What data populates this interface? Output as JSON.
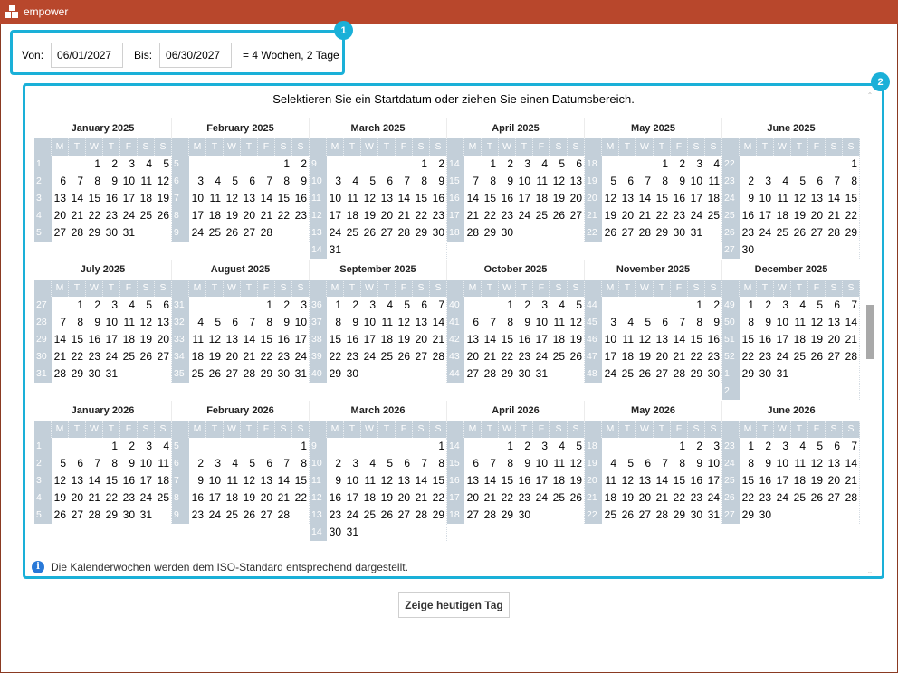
{
  "app": {
    "title": "empower"
  },
  "range": {
    "from_label": "Von:",
    "from_value": "06/01/2027",
    "to_label": "Bis:",
    "to_value": "06/30/2027",
    "result": "= 4 Wochen, 2 Tage",
    "badge": "1"
  },
  "calendar": {
    "badge": "2",
    "heading": "Selektieren Sie ein Startdatum oder ziehen Sie einen Datumsbereich.",
    "weekday_headers": [
      "M",
      "T",
      "W",
      "T",
      "F",
      "S",
      "S"
    ],
    "months": [
      {
        "name": "January 2025",
        "offset": 2,
        "days": 31,
        "weeks": [
          "1",
          "2",
          "3",
          "4",
          "5"
        ]
      },
      {
        "name": "February 2025",
        "offset": 5,
        "days": 28,
        "weeks": [
          "5",
          "6",
          "7",
          "8",
          "9"
        ]
      },
      {
        "name": "March 2025",
        "offset": 5,
        "days": 31,
        "weeks": [
          "9",
          "10",
          "11",
          "12",
          "13",
          "14"
        ]
      },
      {
        "name": "April 2025",
        "offset": 1,
        "days": 30,
        "weeks": [
          "14",
          "15",
          "16",
          "17",
          "18"
        ]
      },
      {
        "name": "May 2025",
        "offset": 3,
        "days": 31,
        "weeks": [
          "18",
          "19",
          "20",
          "21",
          "22"
        ]
      },
      {
        "name": "June 2025",
        "offset": 6,
        "days": 30,
        "weeks": [
          "22",
          "23",
          "24",
          "25",
          "26",
          "27"
        ]
      },
      {
        "name": "July 2025",
        "offset": 1,
        "days": 31,
        "weeks": [
          "27",
          "28",
          "29",
          "30",
          "31"
        ]
      },
      {
        "name": "August 2025",
        "offset": 4,
        "days": 31,
        "weeks": [
          "31",
          "32",
          "33",
          "34",
          "35"
        ]
      },
      {
        "name": "September 2025",
        "offset": 0,
        "days": 30,
        "weeks": [
          "36",
          "37",
          "38",
          "39",
          "40"
        ]
      },
      {
        "name": "October 2025",
        "offset": 2,
        "days": 31,
        "weeks": [
          "40",
          "41",
          "42",
          "43",
          "44"
        ]
      },
      {
        "name": "November 2025",
        "offset": 5,
        "days": 30,
        "weeks": [
          "44",
          "45",
          "46",
          "47",
          "48"
        ]
      },
      {
        "name": "December 2025",
        "offset": 0,
        "days": 31,
        "weeks": [
          "49",
          "50",
          "51",
          "52",
          "1",
          "2"
        ]
      },
      {
        "name": "January 2026",
        "offset": 3,
        "days": 31,
        "weeks": [
          "1",
          "2",
          "3",
          "4",
          "5"
        ]
      },
      {
        "name": "February 2026",
        "offset": 6,
        "days": 28,
        "weeks": [
          "5",
          "6",
          "7",
          "8",
          "9"
        ]
      },
      {
        "name": "March 2026",
        "offset": 6,
        "days": 31,
        "weeks": [
          "9",
          "10",
          "11",
          "12",
          "13",
          "14"
        ]
      },
      {
        "name": "April 2026",
        "offset": 2,
        "days": 30,
        "weeks": [
          "14",
          "15",
          "16",
          "17",
          "18"
        ]
      },
      {
        "name": "May 2026",
        "offset": 4,
        "days": 31,
        "weeks": [
          "18",
          "19",
          "20",
          "21",
          "22"
        ]
      },
      {
        "name": "June 2026",
        "offset": 0,
        "days": 30,
        "weeks": [
          "23",
          "24",
          "25",
          "26",
          "27"
        ]
      }
    ],
    "info_text": "Die Kalenderwochen werden dem ISO-Standard entsprechend dargestellt."
  },
  "buttons": {
    "today": "Zeige heutigen Tag"
  },
  "colors": {
    "titlebar": "#b8472c",
    "accent": "#1ab0d8",
    "week_bg": "#c3cfd9",
    "info": "#2979d8"
  },
  "icons": {
    "app": "app-logo-icon",
    "info": "info-icon"
  }
}
